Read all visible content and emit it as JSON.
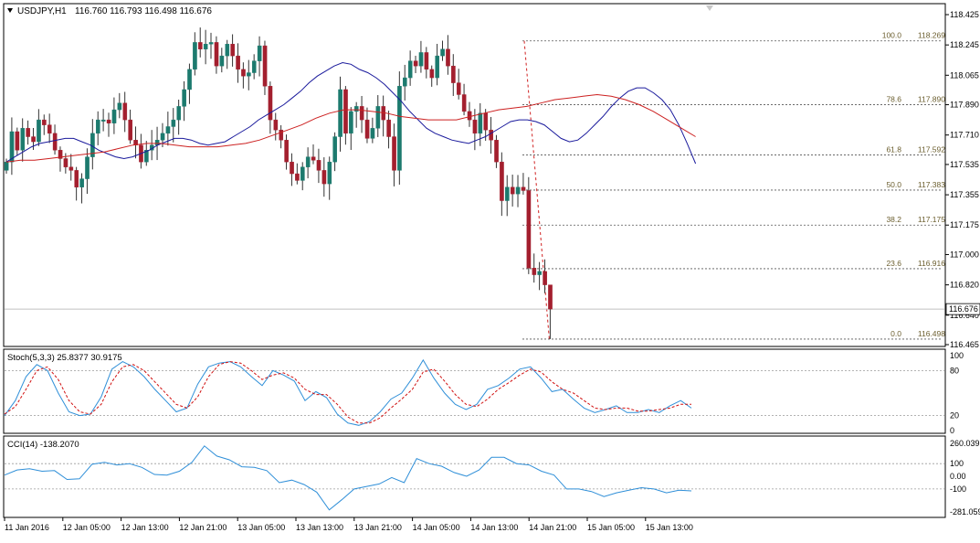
{
  "header": {
    "symbol": "USDJPY,H1",
    "ohlc": "116.760 116.793 116.498 116.676"
  },
  "colors": {
    "bull": "#1c7a6e",
    "bear": "#a31f2e",
    "ma_fast": "#1a1a9c",
    "ma_slow": "#cc2020",
    "fib": "#555555",
    "fib_label": "#6b5e2e",
    "stoch_main": "#2f8fd8",
    "stoch_signal": "#d01010",
    "cci": "#2f8fd8",
    "border": "#000000"
  },
  "chart_data": [
    {
      "type": "candlestick",
      "panel": "price",
      "ylim": [
        116.465,
        118.425
      ],
      "yticks": [
        "118.425",
        "118.245",
        "118.065",
        "117.890",
        "117.710",
        "117.535",
        "117.355",
        "117.175",
        "117.000",
        "116.820",
        "116.640",
        "116.465"
      ],
      "current_price": "116.676",
      "x_labels": [
        "11 Jan 2016",
        "12 Jan 05:00",
        "12 Jan 13:00",
        "12 Jan 21:00",
        "13 Jan 05:00",
        "13 Jan 13:00",
        "13 Jan 21:00",
        "14 Jan 05:00",
        "14 Jan 13:00",
        "14 Jan 21:00",
        "15 Jan 05:00",
        "15 Jan 13:00"
      ],
      "close": [
        117.55,
        117.73,
        117.62,
        117.75,
        117.7,
        117.67,
        117.8,
        117.77,
        117.72,
        117.62,
        117.57,
        117.52,
        117.5,
        117.4,
        117.45,
        117.58,
        117.72,
        117.8,
        117.8,
        117.78,
        117.86,
        117.9,
        117.8,
        117.68,
        117.65,
        117.55,
        117.62,
        117.65,
        117.68,
        117.72,
        117.76,
        117.8,
        117.88,
        117.98,
        118.1,
        118.26,
        118.22,
        118.25,
        118.26,
        118.12,
        118.18,
        118.25,
        118.18,
        118.1,
        118.06,
        118.08,
        118.15,
        118.24,
        118.0,
        117.8,
        117.74,
        117.68,
        117.55,
        117.48,
        117.44,
        117.52,
        117.58,
        117.56,
        117.5,
        117.42,
        117.55,
        117.7,
        117.98,
        117.72,
        117.85,
        117.88,
        117.8,
        117.69,
        117.75,
        117.88,
        117.8,
        117.7,
        117.5,
        118.0,
        118.05,
        118.15,
        118.12,
        118.2,
        118.1,
        118.05,
        118.18,
        118.22,
        118.12,
        118.02,
        117.95,
        117.85,
        117.8,
        117.72,
        117.84,
        117.74,
        117.68,
        117.55,
        117.32,
        117.4,
        117.36,
        117.4,
        117.38,
        116.92,
        116.88,
        116.9,
        116.82,
        116.676
      ],
      "ma_fast": [
        117.55,
        117.58,
        117.61,
        117.64,
        117.66,
        117.67,
        117.68,
        117.69,
        117.69,
        117.67,
        117.65,
        117.62,
        117.6,
        117.58,
        117.57,
        117.58,
        117.6,
        117.62,
        117.65,
        117.67,
        117.69,
        117.69,
        117.68,
        117.66,
        117.65,
        117.66,
        117.67,
        117.7,
        117.73,
        117.76,
        117.8,
        117.83,
        117.86,
        117.89,
        117.93,
        117.97,
        118.02,
        118.06,
        118.09,
        118.12,
        118.14,
        118.13,
        118.1,
        118.08,
        118.05,
        118.01,
        117.96,
        117.91,
        117.85,
        117.8,
        117.75,
        117.72,
        117.7,
        117.68,
        117.67,
        117.66,
        117.68,
        117.7,
        117.73,
        117.76,
        117.79,
        117.8,
        117.8,
        117.79,
        117.77,
        117.73,
        117.69,
        117.67,
        117.68,
        117.72,
        117.77,
        117.82,
        117.88,
        117.93,
        117.97,
        117.99,
        117.99,
        117.96,
        117.92,
        117.86,
        117.77,
        117.66,
        117.54
      ],
      "ma_slow": [
        117.55,
        117.56,
        117.56,
        117.57,
        117.58,
        117.59,
        117.6,
        117.61,
        117.63,
        117.65,
        117.66,
        117.66,
        117.65,
        117.64,
        117.64,
        117.64,
        117.65,
        117.66,
        117.68,
        117.71,
        117.74,
        117.77,
        117.81,
        117.84,
        117.86,
        117.86,
        117.85,
        117.84,
        117.82,
        117.81,
        117.8,
        117.8,
        117.8,
        117.82,
        117.84,
        117.86,
        117.87,
        117.88,
        117.9,
        117.92,
        117.93,
        117.94,
        117.95,
        117.94,
        117.92,
        117.89,
        117.85,
        117.8,
        117.75,
        117.7
      ],
      "fib_levels": [
        {
          "pct": "100.0",
          "price": "118.269"
        },
        {
          "pct": "78.6",
          "price": "117.890"
        },
        {
          "pct": "61.8",
          "price": "117.592"
        },
        {
          "pct": "50.0",
          "price": "117.383"
        },
        {
          "pct": "38.2",
          "price": "117.175"
        },
        {
          "pct": "23.6",
          "price": "116.916"
        },
        {
          "pct": "0.0",
          "price": "116.498"
        }
      ]
    },
    {
      "type": "line",
      "panel": "stochastic",
      "title": "Stoch(5,3,3) 25.8377 30.9175",
      "ylim": [
        0,
        100
      ],
      "yticks": [
        "100",
        "80",
        "20",
        "0"
      ],
      "series": [
        {
          "name": "Main",
          "values": [
            20,
            40,
            72,
            88,
            80,
            50,
            25,
            20,
            22,
            45,
            82,
            92,
            85,
            72,
            55,
            40,
            25,
            30,
            62,
            85,
            90,
            92,
            85,
            72,
            60,
            80,
            74,
            66,
            40,
            52,
            44,
            22,
            10,
            7,
            12,
            25,
            42,
            50,
            70,
            94,
            70,
            50,
            35,
            28,
            35,
            55,
            60,
            70,
            82,
            85,
            70,
            52,
            55,
            42,
            30,
            24,
            28,
            33,
            24,
            24,
            28,
            24,
            33,
            40,
            30
          ]
        },
        {
          "name": "Signal",
          "values": [
            22,
            32,
            55,
            80,
            85,
            68,
            40,
            25,
            22,
            35,
            65,
            85,
            88,
            80,
            65,
            50,
            35,
            30,
            45,
            72,
            88,
            92,
            90,
            80,
            68,
            74,
            77,
            70,
            55,
            48,
            48,
            35,
            18,
            10,
            10,
            17,
            30,
            42,
            55,
            78,
            82,
            66,
            48,
            35,
            32,
            42,
            55,
            64,
            74,
            82,
            78,
            65,
            55,
            50,
            40,
            30,
            28,
            30,
            30,
            26,
            26,
            28,
            30,
            35,
            35
          ]
        }
      ]
    },
    {
      "type": "line",
      "panel": "cci",
      "title": "CCI(14) -138.2070",
      "ylim": [
        -281.059,
        260.039
      ],
      "yticks": [
        "260.039",
        "100",
        "0.00",
        "-100",
        "-281.059"
      ],
      "series": [
        {
          "name": "CCI",
          "values": [
            10,
            50,
            60,
            40,
            45,
            -25,
            -20,
            95,
            110,
            90,
            100,
            70,
            15,
            10,
            40,
            110,
            240,
            160,
            130,
            75,
            70,
            45,
            -50,
            -30,
            -65,
            -125,
            -265,
            -185,
            -100,
            -80,
            -60,
            -10,
            -50,
            140,
            100,
            80,
            30,
            0,
            50,
            150,
            150,
            100,
            90,
            40,
            10,
            -100,
            -100,
            -120,
            -160,
            -130,
            -110,
            -90,
            -100,
            -130,
            -110,
            -115
          ]
        }
      ]
    }
  ]
}
